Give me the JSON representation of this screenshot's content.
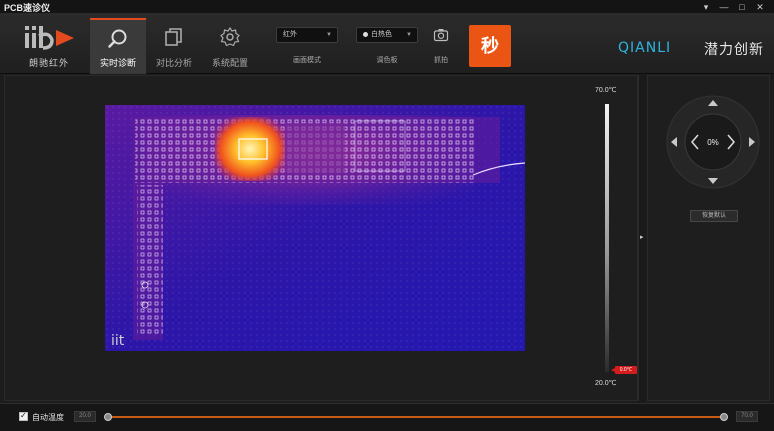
{
  "window": {
    "title": "PCB速诊仪",
    "minimize_label": "—",
    "maximize_label": "□",
    "close_label": "✕",
    "pin_label": "▾"
  },
  "brand": {
    "logo_text": "iit",
    "name": "朗驰红外",
    "accent_color": "#e34b1f"
  },
  "tabs": [
    {
      "label": "实时诊断",
      "icon": "search-icon",
      "active": true
    },
    {
      "label": "对比分析",
      "icon": "copy-icon",
      "active": false
    },
    {
      "label": "系统配置",
      "icon": "gear-icon",
      "active": false
    }
  ],
  "controls": {
    "mode_select": {
      "value": "红外",
      "label": "画面模式"
    },
    "palette_select": {
      "value": "白热色",
      "label": "调色板"
    },
    "snapshot": {
      "label": "抓拍",
      "icon": "camera-icon"
    },
    "second_button": {
      "label": "秒",
      "color": "#ea5513"
    }
  },
  "company": {
    "name_en": "QIANLI",
    "name_cn": "潜力创新",
    "color": "#2db4e0"
  },
  "thermal_view": {
    "watermark": "iit"
  },
  "temperature_scale": {
    "max_label": "70.0℃",
    "min_label": "20.0℃",
    "marker_label": "0.0℃"
  },
  "ptz": {
    "zoom_label": "0%",
    "reset_label": "恢复默认"
  },
  "bottom": {
    "auto_temp_label": "自动温度",
    "auto_temp_checked": true,
    "range_min": "20.0",
    "range_max": "70.0"
  }
}
